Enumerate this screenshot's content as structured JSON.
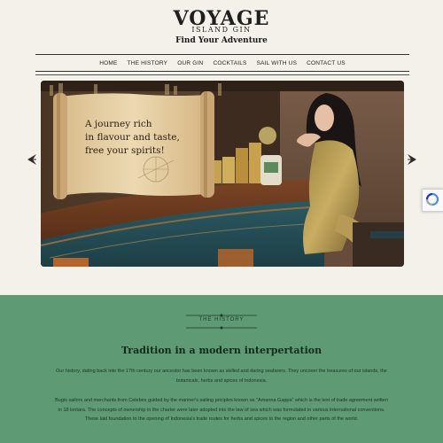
{
  "brand": {
    "name": "VOYAGE",
    "subtitle": "ISLAND GIN",
    "tagline": "Find Your Adventure"
  },
  "nav": {
    "items": [
      "HOME",
      "THE HISTORY",
      "OUR GIN",
      "COCKTAILS",
      "SAIL WITH US",
      "CONTACT US"
    ]
  },
  "hero": {
    "line1": "A journey rich",
    "line2": "in flavour and taste,",
    "line3": "free your spirits!"
  },
  "history": {
    "section_label": "THE HISTORY",
    "title": "Tradition in a modern interpertation",
    "paragraph1": "Our history, dating back into the 17th century our ancestor has been known as skilled and daring seafarers. They uncover the treasures of our islands, the botanicals, herbs and spices of Indonesia.",
    "paragraph2": "Bugis sailors and merchants from Celebes guided by the mariner's sailing priciples known as \"Amanna Gappa\" which is the text of trade agreement written in 18 lontara. The concepts of ownership in the charter were later adopted into the law of sea which was formulated in various international conventions. These laid foundation to the opening of Indonesia's trade routes for herbs and spices to the region and other parts of the world."
  },
  "colors": {
    "background": "#f3f1ea",
    "history_green": "#5e9a73",
    "text_dark": "#222222"
  }
}
